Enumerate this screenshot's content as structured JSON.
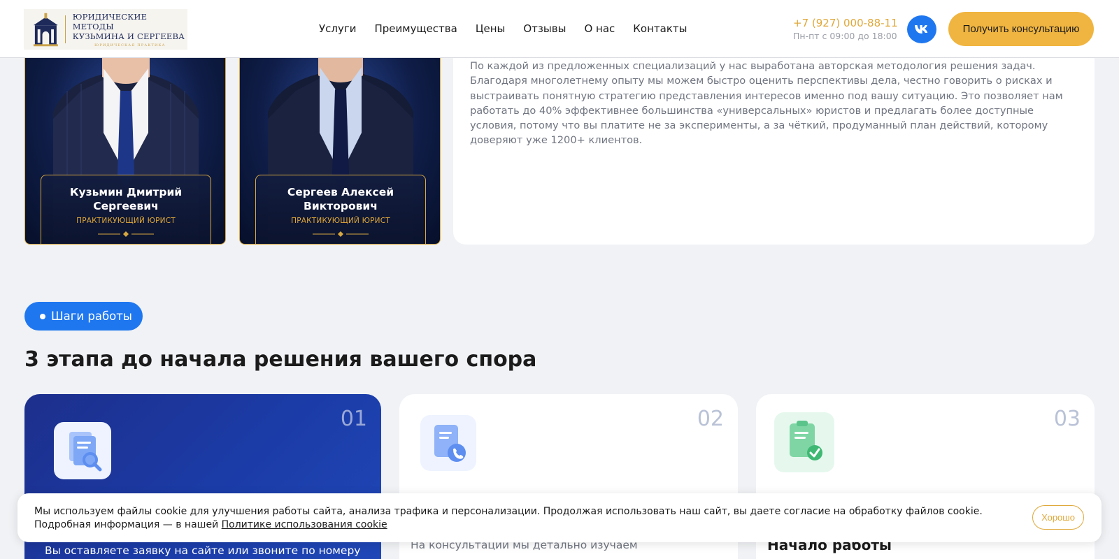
{
  "header": {
    "logo": {
      "line1": "ЮРИДИЧЕСКИЕ МЕТОДЫ",
      "line2": "КУЗЬМИНА И СЕРГЕЕВА",
      "sub": "ЮРИДИЧЕСКАЯ ПРАКТИКА"
    },
    "nav": [
      {
        "label": "Услуги"
      },
      {
        "label": "Преимущества"
      },
      {
        "label": "Цены"
      },
      {
        "label": "Отзывы"
      },
      {
        "label": "О нас"
      },
      {
        "label": "Контакты"
      }
    ],
    "phone": "+7 (927) 000-88-11",
    "hours": "Пн-пт с 09:00 до 18:00",
    "vk_icon": "vk-icon",
    "cta_label": "Получить консультацию"
  },
  "lawyers": [
    {
      "name": "Кузьмин Дмитрий Сергеевич",
      "role": "ПРАКТИКУЮЩИЙ ЮРИСТ"
    },
    {
      "name": "Сергеев Алексей Викторович",
      "role": "ПРАКТИКУЮЩИЙ ЮРИСТ"
    }
  ],
  "about_text": "По каждой из предложенных специализаций у нас выработана авторская методология решения задач. Благодаря многолетнему опыту мы можем быстро оценить перспективы дела, честно говорить о рисках и выстраивать понятную стратегию представления интересов именно под вашу ситуацию. Это позволяет нам работать до 40% эффективнее большинства «универсальных» юристов и предлагать более доступные условия, потому что вы платите не за эксперименты, а за чёткий, продуманный план действий, которому доверяют уже 1200+ клиентов.",
  "steps_section": {
    "pill": "Шаги работы",
    "title": "3 этапа до начала решения вашего спора",
    "steps": [
      {
        "num": "01",
        "icon": "document-search-icon",
        "text": "Вы оставляете заявку на сайте или звоните по номеру"
      },
      {
        "num": "02",
        "icon": "document-phone-icon",
        "text": "На консультации мы детально изучаем"
      },
      {
        "num": "03",
        "icon": "document-check-icon",
        "title": "Начало работы"
      }
    ]
  },
  "cookie": {
    "text": "Мы используем файлы cookie для улучшения работы сайта, анализа трафика и персонализации. Продолжая использовать наш сайт, вы даете согласие на обработку файлов cookie. Подробная информация — в нашей ",
    "link": "Политике использования cookie",
    "button": "Хорошо"
  },
  "colors": {
    "accent_blue": "#1f77f0",
    "accent_gold": "#f0b540",
    "navy": "#1d2f8c"
  }
}
